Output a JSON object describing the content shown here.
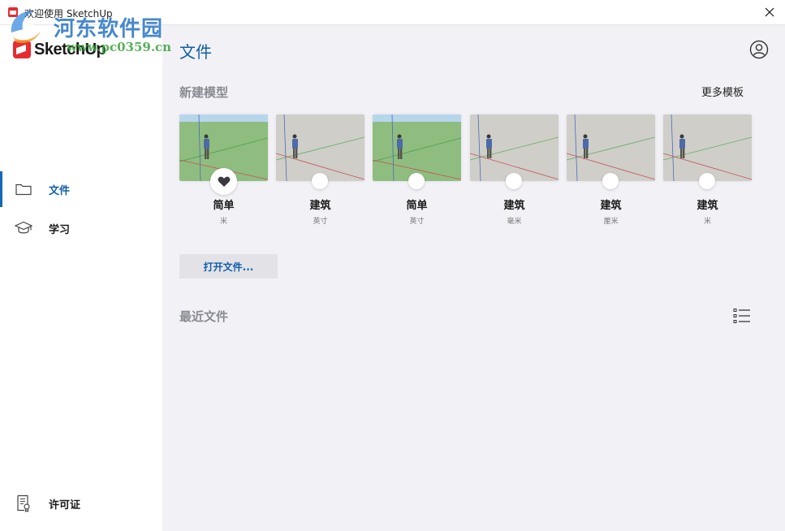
{
  "window": {
    "title": "欢迎使用 SketchUp",
    "close_icon": "close-icon"
  },
  "watermark": {
    "site_name": "河东软件园",
    "url": "www.pc0359.cn"
  },
  "sidebar": {
    "logo_text": "SketchUp",
    "items": [
      {
        "label": "文件",
        "icon": "folder-icon",
        "active": true
      },
      {
        "label": "学习",
        "icon": "graduation-cap-icon",
        "active": false
      }
    ],
    "footer_item": {
      "label": "许可证",
      "icon": "license-icon"
    }
  },
  "main": {
    "title": "文件",
    "user_icon": "user-icon",
    "new_model": {
      "heading": "新建模型",
      "more_templates": "更多模板",
      "templates": [
        {
          "name": "简单",
          "unit": "米",
          "style": "green",
          "favorite": true
        },
        {
          "name": "建筑",
          "unit": "英寸",
          "style": "gray",
          "favorite": false
        },
        {
          "name": "简单",
          "unit": "英寸",
          "style": "green",
          "favorite": false
        },
        {
          "name": "建筑",
          "unit": "毫米",
          "style": "gray",
          "favorite": false
        },
        {
          "name": "建筑",
          "unit": "厘米",
          "style": "gray",
          "favorite": false
        },
        {
          "name": "建筑",
          "unit": "米",
          "style": "gray",
          "favorite": false
        }
      ]
    },
    "open_file_button": "打开文件...",
    "recent": {
      "heading": "最近文件",
      "view_icon": "list-view-icon"
    }
  },
  "colors": {
    "accent": "#0f5ea8",
    "background": "#f2f1f6",
    "sidebar": "#ffffff",
    "green_template_ground": "#8fbd7f",
    "green_template_sky": "#b7d6ec",
    "gray_template_ground": "#cfcec9"
  }
}
